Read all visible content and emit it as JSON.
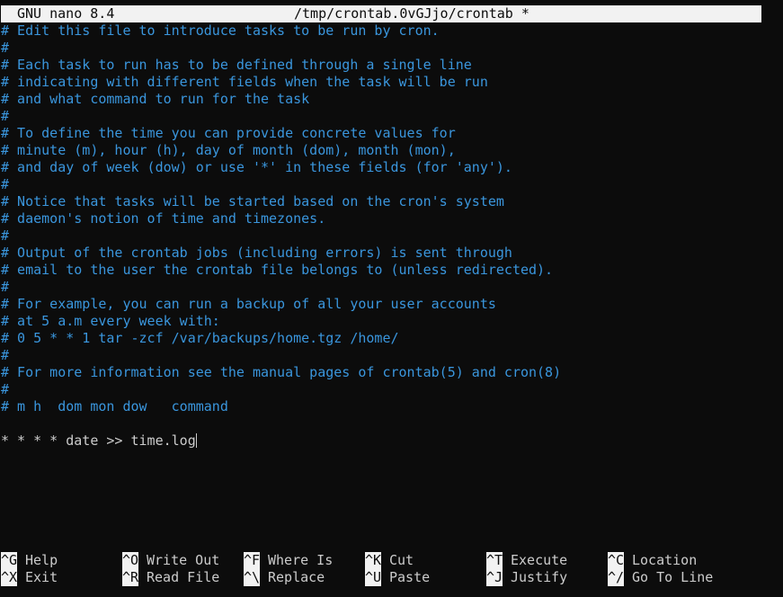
{
  "titlebar": {
    "app": "GNU nano 8.4",
    "file": "/tmp/crontab.0vGJjo/crontab *"
  },
  "editor": {
    "comment_lines": [
      "# Edit this file to introduce tasks to be run by cron.",
      "#",
      "# Each task to run has to be defined through a single line",
      "# indicating with different fields when the task will be run",
      "# and what command to run for the task",
      "#",
      "# To define the time you can provide concrete values for",
      "# minute (m), hour (h), day of month (dom), month (mon),",
      "# and day of week (dow) or use '*' in these fields (for 'any').",
      "#",
      "# Notice that tasks will be started based on the cron's system",
      "# daemon's notion of time and timezones.",
      "#",
      "# Output of the crontab jobs (including errors) is sent through",
      "# email to the user the crontab file belongs to (unless redirected).",
      "#",
      "# For example, you can run a backup of all your user accounts",
      "# at 5 a.m every week with:",
      "# 0 5 * * 1 tar -zcf /var/backups/home.tgz /home/",
      "#",
      "# For more information see the manual pages of crontab(5) and cron(8)",
      "#",
      "# m h  dom mon dow   command"
    ],
    "blank_line": "",
    "command_line": "* * * * date >> time.log"
  },
  "shortcuts": [
    {
      "key": "^G",
      "label": "Help"
    },
    {
      "key": "^O",
      "label": "Write Out"
    },
    {
      "key": "^F",
      "label": "Where Is"
    },
    {
      "key": "^K",
      "label": "Cut"
    },
    {
      "key": "^T",
      "label": "Execute"
    },
    {
      "key": "^C",
      "label": "Location"
    },
    {
      "key": "^X",
      "label": "Exit"
    },
    {
      "key": "^R",
      "label": "Read File"
    },
    {
      "key": "^\\",
      "label": "Replace"
    },
    {
      "key": "^U",
      "label": "Paste"
    },
    {
      "key": "^J",
      "label": "Justify"
    },
    {
      "key": "^/",
      "label": "Go To Line"
    }
  ]
}
